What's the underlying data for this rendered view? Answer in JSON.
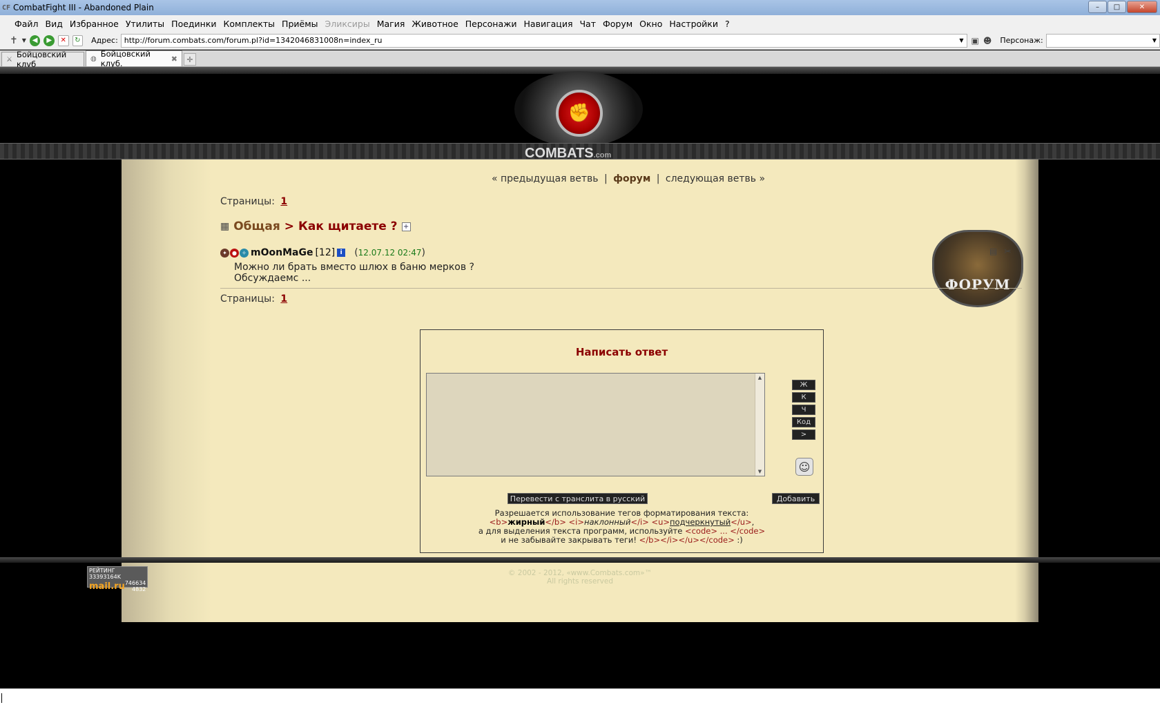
{
  "window": {
    "app_icon": "CF",
    "title": "CombatFight III - Abandoned Plain",
    "minimize": "–",
    "maximize": "□",
    "close": "✕"
  },
  "menu": [
    "Файл",
    "Вид",
    "Избранное",
    "Утилиты",
    "Поединки",
    "Комплекты",
    "Приёмы",
    "Эликсиры",
    "Магия",
    "Животное",
    "Персонажи",
    "Навигация",
    "Чат",
    "Форум",
    "Окно",
    "Настройки",
    "?"
  ],
  "address": {
    "label": "Адрес:",
    "url": "http://forum.combats.com/forum.pl?id=1342046831008n=index_ru",
    "persona_label": "Персонаж:",
    "persona_value": ""
  },
  "tabs": [
    {
      "label": "Бойцовский клуб"
    },
    {
      "label": "Бойцовский клуб."
    }
  ],
  "brand": {
    "name": "COMBATS",
    "suffix": ".com"
  },
  "nav": {
    "prev": "« предыдущая ветвь",
    "forum": "форум",
    "next": "следующая ветвь »",
    "sep": "|"
  },
  "pages": {
    "label": "Страницы:",
    "current": "1"
  },
  "thread": {
    "category": "Общая",
    "arrow": ">",
    "topic": "Как щитаете ?",
    "plus": "+"
  },
  "post": {
    "nick": "mOonMaGe",
    "level": "[12]",
    "info": "i",
    "date": "12.07.12 02:47",
    "lines": [
      "Можно ли брать вместо шлюх в баню мерков ?",
      "Обсуждаемс ..."
    ]
  },
  "forum_sign": "ФОРУМ",
  "reply": {
    "title": "Написать ответ",
    "buttons": [
      "Ж",
      "К",
      "Ч",
      "Код",
      ">"
    ],
    "translit": "Перевести с транслита в русский",
    "add": "Добавить",
    "help_line1": "Разрешается использование тегов форматирования текста:",
    "help_b_open": "<b>",
    "help_b_text": "жирный",
    "help_b_close": "</b>",
    "help_i_open": "<i>",
    "help_i_text": "наклонный",
    "help_i_close": "</i>",
    "help_u_open": "<u>",
    "help_u_text": "подчеркнутый",
    "help_u_close": "</u>",
    "help_line3a": "а для выделения текста программ, используйте",
    "help_code": "<code> ... </code>",
    "help_line4a": "и не забывайте закрывать теги!",
    "help_closing": "</b></i></u></code>",
    "help_line4b": ":)"
  },
  "footer": {
    "counter_title": "РЕЙТИНГ",
    "counter_num1": "33393164K",
    "counter_logo": "mail.ru",
    "counter_num2": "746634",
    "counter_num3": "4832",
    "copyright": "© 2002 - 2012, «www.Combats.com»™",
    "rights": "All rights reserved"
  }
}
